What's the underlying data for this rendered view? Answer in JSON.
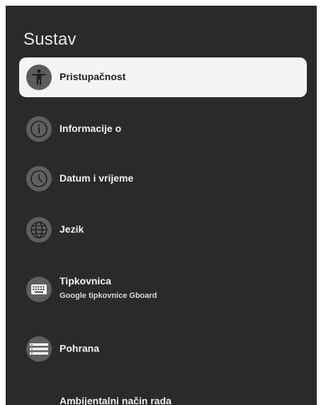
{
  "page": {
    "title": "Sustav"
  },
  "menu": {
    "items": [
      {
        "label": "Pristupačnost",
        "icon": "accessibility-icon",
        "selected": true
      },
      {
        "label": "Informacije o",
        "icon": "info-icon"
      },
      {
        "label": "Datum i vrijeme",
        "icon": "clock-icon"
      },
      {
        "label": "Jezik",
        "icon": "globe-icon"
      },
      {
        "label": "Tipkovnica",
        "sublabel": "Google tipkovnice Gboard",
        "icon": "keyboard-icon"
      },
      {
        "label": "Pohrana",
        "icon": "storage-icon"
      },
      {
        "label": "Ambijentalni način rada"
      }
    ]
  },
  "colors": {
    "background": "#2a2a2a",
    "selected_background": "#f4f4f4",
    "icon_circle": "#5f5f5f",
    "text": "#f2f2f2",
    "selected_text": "#1e1e1e"
  }
}
